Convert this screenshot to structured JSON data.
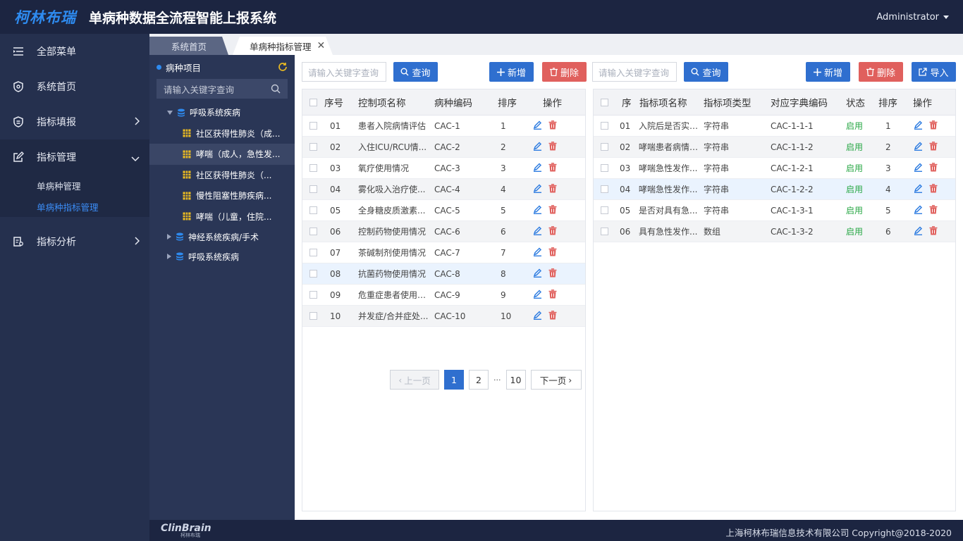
{
  "header": {
    "logo": "柯林布瑞",
    "title": "单病种数据全流程智能上报系统",
    "user": "Administrator"
  },
  "nav": {
    "items": [
      {
        "label": "全部菜单",
        "icon": "menu-fold-icon"
      },
      {
        "label": "系统首页",
        "icon": "shield-icon"
      },
      {
        "label": "指标填报",
        "icon": "shield-form-icon"
      },
      {
        "label": "指标管理",
        "icon": "edit-icon"
      },
      {
        "label": "指标分析",
        "icon": "analysis-icon"
      }
    ],
    "sub": [
      {
        "label": "单病种管理"
      },
      {
        "label": "单病种指标管理"
      }
    ]
  },
  "tabs": {
    "home": "系统首页",
    "current": "单病种指标管理"
  },
  "tree": {
    "title": "病种项目",
    "search_placeholder": "请输入关键字查询",
    "nodes": [
      {
        "label": "呼吸系统疾病"
      },
      {
        "label": "社区获得性肺炎（成..."
      },
      {
        "label": "哮喘（成人，急性发..."
      },
      {
        "label": "社区获得性肺炎（..."
      },
      {
        "label": "慢性阻塞性肺疾病..."
      },
      {
        "label": "哮喘（儿童，住院..."
      },
      {
        "label": "神经系统疾病/手术"
      },
      {
        "label": "呼吸系统疾病"
      }
    ]
  },
  "left_toolbar": {
    "search_placeholder": "请输入关键字查询",
    "query": "查询",
    "add": "新增",
    "delete": "删除"
  },
  "right_toolbar": {
    "search_placeholder": "请输入关键字查询",
    "query": "查询",
    "add": "新增",
    "delete": "删除",
    "import": "导入"
  },
  "left_table": {
    "headers": [
      "序号",
      "控制项名称",
      "病种编码",
      "排序",
      "操作"
    ],
    "rows": [
      {
        "no": "01",
        "name": "患者入院病情评估",
        "code": "CAC-1",
        "sort": "1"
      },
      {
        "no": "02",
        "name": "入住ICU/RCU情...",
        "code": "CAC-2",
        "sort": "2"
      },
      {
        "no": "03",
        "name": "氧疗使用情况",
        "code": "CAC-3",
        "sort": "3"
      },
      {
        "no": "04",
        "name": "雾化吸入治疗使...",
        "code": "CAC-4",
        "sort": "4"
      },
      {
        "no": "05",
        "name": "全身糖皮质激素...",
        "code": "CAC-5",
        "sort": "5"
      },
      {
        "no": "06",
        "name": "控制药物使用情况",
        "code": "CAC-6",
        "sort": "6"
      },
      {
        "no": "07",
        "name": "茶碱制剂使用情况",
        "code": "CAC-7",
        "sort": "7"
      },
      {
        "no": "08",
        "name": "抗菌药物使用情况",
        "code": "CAC-8",
        "sort": "8"
      },
      {
        "no": "09",
        "name": "危重症患者使用机...",
        "code": "CAC-9",
        "sort": "9"
      },
      {
        "no": "10",
        "name": "并发症/合并症处...",
        "code": "CAC-10",
        "sort": "10"
      }
    ]
  },
  "pager": {
    "prev": "上一页",
    "next": "下一页",
    "pages": [
      "1",
      "2",
      "10"
    ],
    "ellipsis": "···"
  },
  "right_table": {
    "headers": [
      "序",
      "指标项名称",
      "指标项类型",
      "对应字典编码",
      "状态",
      "排序",
      "操作"
    ],
    "rows": [
      {
        "no": "01",
        "name": "入院后是否实施...",
        "type": "字符串",
        "dict": "CAC-1-1-1",
        "status": "启用",
        "sort": "1"
      },
      {
        "no": "02",
        "name": "哮喘患者病情严...",
        "type": "字符串",
        "dict": "CAC-1-1-2",
        "status": "启用",
        "sort": "2"
      },
      {
        "no": "03",
        "name": "哮喘急性发作...",
        "type": "字符串",
        "dict": "CAC-1-2-1",
        "status": "启用",
        "sort": "3"
      },
      {
        "no": "04",
        "name": "哮喘急性发作...",
        "type": "字符串",
        "dict": "CAC-1-2-2",
        "status": "启用",
        "sort": "4"
      },
      {
        "no": "05",
        "name": "是否对具有急...",
        "type": "字符串",
        "dict": "CAC-1-3-1",
        "status": "启用",
        "sort": "5"
      },
      {
        "no": "06",
        "name": "具有急性发作...",
        "type": "数组",
        "dict": "CAC-1-3-2",
        "status": "启用",
        "sort": "6"
      }
    ]
  },
  "footer": {
    "logo": "ClinBrain",
    "logo_sub": "柯林布瑞",
    "copyright": "上海柯林布瑞信息技术有限公司 Copyright@2018-2020"
  },
  "colors": {
    "accent": "#2f6fcf",
    "danger": "#e0605d",
    "status_on": "#28a745",
    "header_bg": "#1c2541"
  }
}
